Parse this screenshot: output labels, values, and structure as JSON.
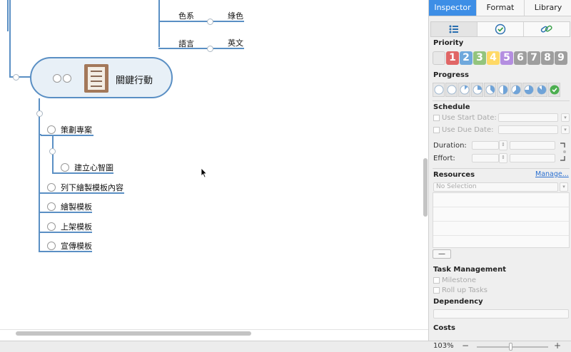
{
  "mindmap": {
    "top_pairs": [
      {
        "key": "色系",
        "value": "綠色"
      },
      {
        "key": "語言",
        "value": "英文"
      }
    ],
    "central_topic": "關鍵行動",
    "subtopics": [
      {
        "label": "策劃專案"
      },
      {
        "label": "建立心智圖"
      },
      {
        "label": "列下繪製模板內容"
      },
      {
        "label": "繪製模板"
      },
      {
        "label": "上架模板"
      },
      {
        "label": "宣傳模板"
      }
    ]
  },
  "inspector": {
    "tabs": [
      "Inspector",
      "Format",
      "Library"
    ],
    "active_tab": "Inspector",
    "subtab_icons": [
      "list-icon",
      "clock-check-icon",
      "attachment-link-icon"
    ],
    "priority": {
      "title": "Priority",
      "levels": [
        {
          "num": "",
          "color": "#e8e8e8"
        },
        {
          "num": "1",
          "color": "#e06666"
        },
        {
          "num": "2",
          "color": "#6fa8dc"
        },
        {
          "num": "3",
          "color": "#93c47d"
        },
        {
          "num": "4",
          "color": "#ffd966"
        },
        {
          "num": "5",
          "color": "#b48ee0"
        },
        {
          "num": "6",
          "color": "#9e9e9e"
        },
        {
          "num": "7",
          "color": "#9e9e9e"
        },
        {
          "num": "8",
          "color": "#9e9e9e"
        },
        {
          "num": "9",
          "color": "#9e9e9e"
        }
      ]
    },
    "progress": {
      "title": "Progress",
      "levels": [
        0,
        0,
        0.125,
        0.25,
        0.375,
        0.5,
        0.625,
        0.75,
        0.875,
        1.0
      ]
    },
    "schedule": {
      "title": "Schedule",
      "use_start_date": "Use Start Date:",
      "use_due_date": "Use Due Date:",
      "duration": "Duration:",
      "effort": "Effort:"
    },
    "resources": {
      "title": "Resources",
      "manage": "Manage...",
      "selection": "No Selection",
      "minus": "—"
    },
    "task_management": {
      "title": "Task Management",
      "milestone": "Milestone",
      "rollup": "Roll up Tasks"
    },
    "dependency": {
      "title": "Dependency"
    },
    "costs": {
      "title": "Costs"
    }
  },
  "zoom": {
    "level": "103%",
    "minus": "−",
    "plus": "+"
  },
  "colors": {
    "accent": "#3d8ee6",
    "branch": "#5a8fc4"
  }
}
